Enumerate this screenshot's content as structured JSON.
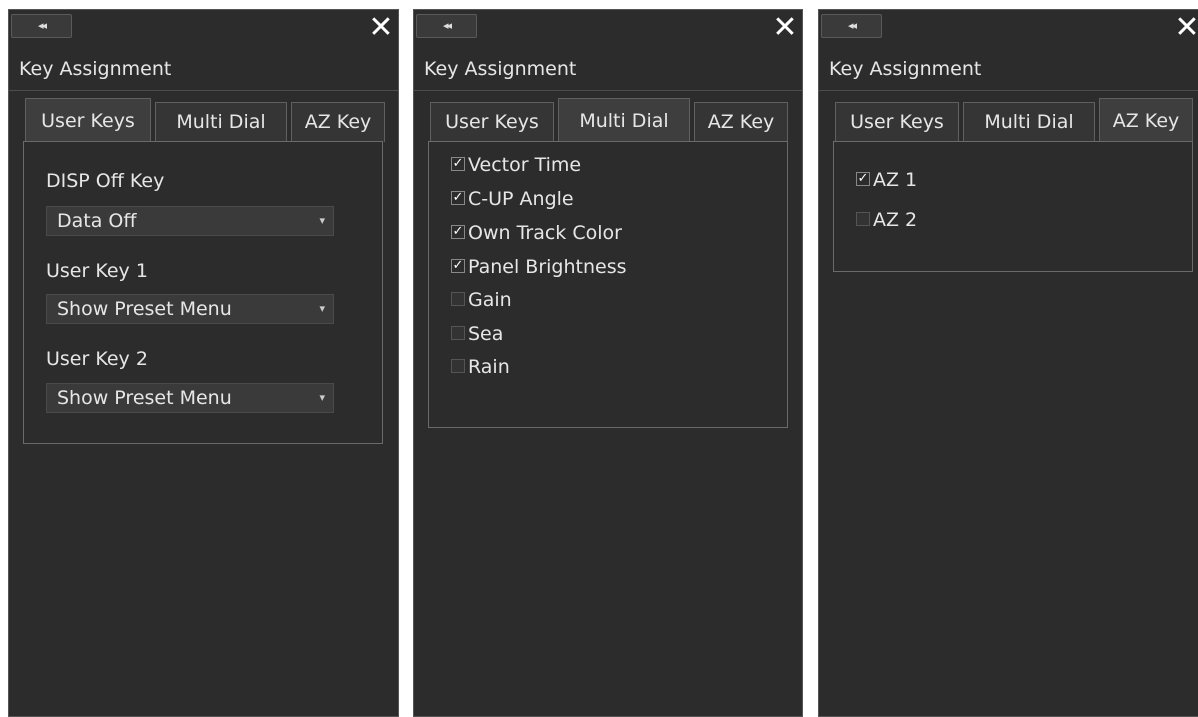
{
  "window": {
    "title": "Key Assignment",
    "collapse_icon": "double-chevron-left-icon",
    "collapse_glyph": "◂◂",
    "close_icon": "close-icon",
    "close_glyph": "✕"
  },
  "tabs": [
    "User Keys",
    "Multi Dial",
    "AZ Key"
  ],
  "user_keys": {
    "disp_off_label": "DISP Off Key",
    "disp_off_value": "Data Off",
    "user_key_1_label": "User Key 1",
    "user_key_1_value": "Show Preset Menu",
    "user_key_2_label": "User Key 2",
    "user_key_2_value": "Show Preset Menu",
    "dropdown_glyph": "▾"
  },
  "multi_dial": {
    "items": [
      {
        "label": "Vector Time",
        "checked": true
      },
      {
        "label": "C-UP Angle",
        "checked": true
      },
      {
        "label": "Own Track Color",
        "checked": true
      },
      {
        "label": "Panel Brightness",
        "checked": true
      },
      {
        "label": "Gain",
        "checked": false
      },
      {
        "label": "Sea",
        "checked": false
      },
      {
        "label": "Rain",
        "checked": false
      }
    ]
  },
  "az_key": {
    "items": [
      {
        "label": "AZ 1",
        "checked": true
      },
      {
        "label": "AZ 2",
        "checked": false
      }
    ]
  },
  "check_glyph": "✓",
  "colors": {
    "panel_bg": "#2c2c2c",
    "text": "#e6e6e6",
    "active_tab": "#3e3e3e"
  }
}
